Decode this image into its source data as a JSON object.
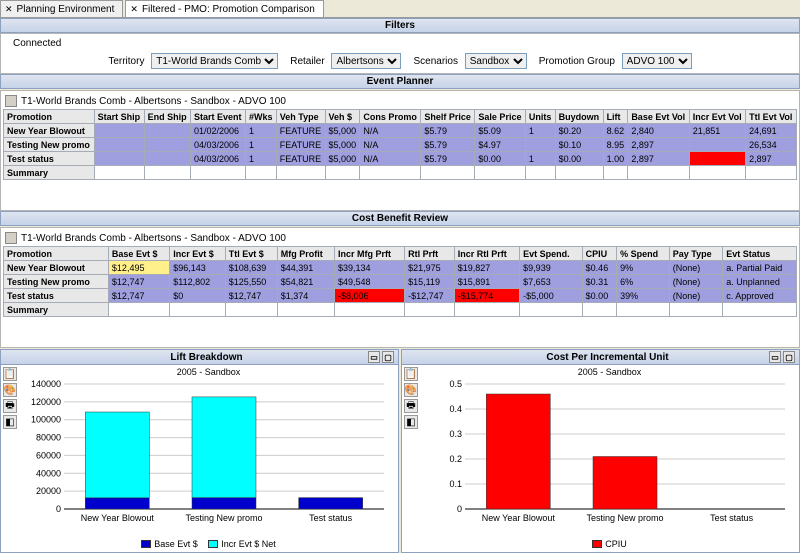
{
  "tabs": {
    "planning": "Planning Environment",
    "filtered": "Filtered - PMO: Promotion Comparison"
  },
  "filters_title": "Filters",
  "connection": "Connected",
  "filters": {
    "territory_label": "Territory",
    "territory_value": "T1-World Brands Comb",
    "retailer_label": "Retailer",
    "retailer_value": "Albertsons",
    "scenarios_label": "Scenarios",
    "scenarios_value": "Sandbox",
    "group_label": "Promotion Group",
    "group_value": "ADVO 100"
  },
  "event_planner": {
    "title": "Event Planner",
    "subtitle": "T1-World Brands Comb - Albertsons - Sandbox - ADVO 100",
    "headers": [
      "Promotion",
      "Start Ship",
      "End Ship",
      "Start Event",
      "#Wks",
      "Veh Type",
      "Veh $",
      "Cons Promo",
      "Shelf Price",
      "Sale Price",
      "Units",
      "Buydown",
      "Lift",
      "Base Evt Vol",
      "Incr Evt Vol",
      "Ttl Evt Vol"
    ],
    "rows": [
      {
        "label": "New Year Blowout",
        "cells": [
          "",
          "",
          "01/02/2006",
          "1",
          "FEATURE",
          "$5,000",
          "N/A",
          "$5.79",
          "$5.09",
          "1",
          "$0.20",
          "8.62",
          "2,840",
          "21,851",
          "24,691"
        ]
      },
      {
        "label": "Testing New promo",
        "cells": [
          "",
          "",
          "04/03/2006",
          "1",
          "FEATURE",
          "$5,000",
          "N/A",
          "$5.79",
          "$4.97",
          "",
          "$0.10",
          "8.95",
          "2,897",
          "",
          "26,534"
        ]
      },
      {
        "label": "Test status",
        "cells": [
          "",
          "",
          "04/03/2006",
          "1",
          "FEATURE",
          "$5,000",
          "N/A",
          "$5.79",
          "$0.00",
          "1",
          "$0.00",
          "1.00",
          "2,897",
          "",
          "2,897"
        ],
        "red_cols": [
          14
        ]
      },
      {
        "label": "Summary",
        "blank": true
      }
    ]
  },
  "cost_benefit": {
    "title": "Cost Benefit Review",
    "subtitle": "T1-World Brands Comb - Albertsons - Sandbox - ADVO 100",
    "headers": [
      "Promotion",
      "Base Evt $",
      "Incr Evt $",
      "Ttl Evt $",
      "Mfg Profit",
      "Incr Mfg Prft",
      "Rtl Prft",
      "Incr Rtl Prft",
      "Evt Spend.",
      "CPIU",
      "% Spend",
      "Pay Type",
      "Evt Status"
    ],
    "rows": [
      {
        "label": "New Year Blowout",
        "cells": [
          "$12,495",
          "$96,143",
          "$108,639",
          "$44,391",
          "$39,134",
          "$21,975",
          "$19,827",
          "$9,939",
          "$0.46",
          "9%",
          "(None)",
          "a. Partial Paid"
        ],
        "yellow_cols": [
          1
        ]
      },
      {
        "label": "Testing New promo",
        "cells": [
          "$12,747",
          "$112,802",
          "$125,550",
          "$54,821",
          "$49,548",
          "$15,119",
          "$15,891",
          "$7,653",
          "$0.31",
          "6%",
          "(None)",
          "a. Unplanned"
        ]
      },
      {
        "label": "Test status",
        "cells": [
          "$12,747",
          "$0",
          "$12,747",
          "$1,374",
          "-$8,006",
          "-$12,747",
          "-$15,774",
          "-$5,000",
          "$0.00",
          "39%",
          "(None)",
          "c. Approved"
        ],
        "red_cols": [
          5,
          7
        ]
      },
      {
        "label": "Summary",
        "blank": true
      }
    ]
  },
  "charts_subtitle": "2005 - Sandbox",
  "lift_chart": {
    "title": "Lift Breakdown",
    "legend": [
      "Base Evt $",
      "Incr Evt $ Net"
    ]
  },
  "cpiu_chart": {
    "title": "Cost Per Incremental Unit",
    "legend": [
      "CPIU"
    ]
  },
  "chart_data": [
    {
      "type": "bar",
      "title": "Lift Breakdown",
      "subtitle": "2005 - Sandbox",
      "categories": [
        "New Year Blowout",
        "Testing New promo",
        "Test status"
      ],
      "series": [
        {
          "name": "Base Evt $",
          "values": [
            12495,
            12747,
            12747
          ],
          "color": "#0000cc"
        },
        {
          "name": "Incr Evt $ Net",
          "values": [
            96143,
            112802,
            0
          ],
          "color": "#00ffff"
        }
      ],
      "stacked": true,
      "ylim": [
        0,
        140000
      ],
      "yticks": [
        0,
        20000,
        40000,
        60000,
        80000,
        100000,
        120000,
        140000
      ]
    },
    {
      "type": "bar",
      "title": "Cost Per Incremental Unit",
      "subtitle": "2005 - Sandbox",
      "categories": [
        "New Year Blowout",
        "Testing New promo",
        "Test status"
      ],
      "series": [
        {
          "name": "CPIU",
          "values": [
            0.46,
            0.21,
            0.0
          ],
          "color": "#ff0000"
        }
      ],
      "ylim": [
        0,
        0.5
      ],
      "yticks": [
        0,
        0.1,
        0.2,
        0.3,
        0.4,
        0.5
      ]
    }
  ]
}
